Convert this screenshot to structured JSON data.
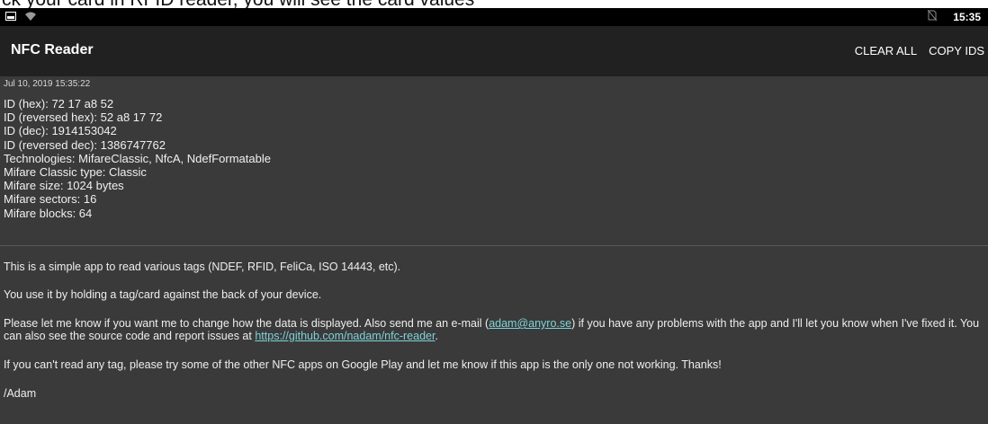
{
  "caption": "ck your card in RFID reader, you will see the card values",
  "status_bar": {
    "time": "15:35",
    "icons": [
      "image-icon",
      "wifi-icon",
      "no-sim-icon"
    ]
  },
  "app_bar": {
    "title": "NFC Reader",
    "actions": [
      "CLEAR ALL",
      "COPY IDS"
    ]
  },
  "scan": {
    "timestamp": "Jul 10, 2019 15:35:22",
    "lines": [
      "ID (hex): 72 17 a8 52",
      "ID (reversed hex): 52 a8 17 72",
      "ID (dec): 1914153042",
      "ID (reversed dec): 1386747762",
      "Technologies: MifareClassic, NfcA, NdefFormatable",
      "Mifare Classic type: Classic",
      "Mifare size: 1024 bytes",
      "Mifare sectors: 16",
      "Mifare blocks: 64"
    ]
  },
  "about": {
    "p1": "This is a simple app to read various tags (NDEF, RFID, FeliCa, ISO 14443, etc).",
    "p2": "You use it by holding a tag/card against the back of your device.",
    "p3_a": "Please let me know if you want me to change how the data is displayed. Also send me an e-mail (",
    "email": "adam@anyro.se",
    "p3_b": ") if you have any problems with the app and I'll let you know when I've fixed it. You can also see the source code and report issues at ",
    "repo_link": "https://github.com/nadam/nfc-reader",
    "p3_c": ".",
    "p4": "If you can't read any tag, please try some of the other NFC apps on Google Play and let me know if this app is the only one not working. Thanks!",
    "signature": "/Adam"
  },
  "colors": {
    "app_bar": "#212121",
    "content_bg": "#3a3a3a",
    "link": "#7fd3d9",
    "status_bar": "#000000"
  }
}
